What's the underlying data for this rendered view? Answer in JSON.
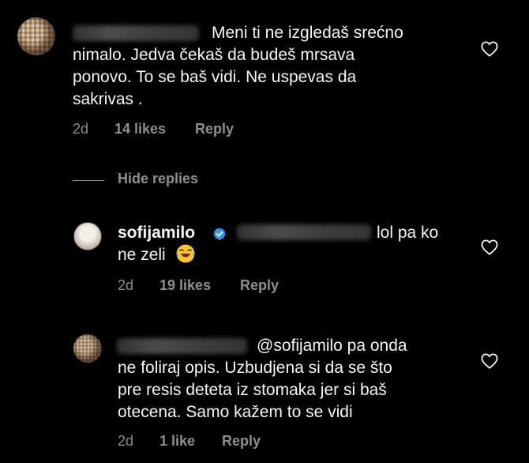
{
  "comments": [
    {
      "text": "Meni ti ne izgledaš srećno\nnimalo. Jedva čekaš da budeš mrsava\nponovo. To se baš vidi. Ne uspevas da\nsakrivas .",
      "time": "2d",
      "likes": "14 likes",
      "reply": "Reply"
    }
  ],
  "hide_replies": "Hide replies",
  "replies": [
    {
      "username": "sofijamilo",
      "text_line1": "lol pa ko",
      "text_line2": "ne zeli",
      "time": "2d",
      "likes": "19 likes",
      "reply": "Reply"
    },
    {
      "mention": "@sofijamilo pa onda",
      "text": "ne foliraj opis. Uzbudjena si da se što\npre resis deteta iz stomaka jer si baš\notecena. Samo kažem to se vidi",
      "time": "2d",
      "likes": "1 like",
      "reply": "Reply"
    }
  ],
  "colors": {
    "background": "#000000",
    "text": "#f5f5f5",
    "meta": "#8e8e8e",
    "verified": "#3897f0"
  },
  "icons": [
    "heart-outline-icon",
    "verified-badge-icon",
    "laughing-emoji-icon"
  ]
}
